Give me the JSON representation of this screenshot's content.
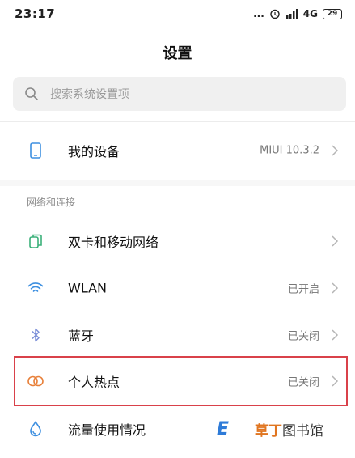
{
  "status_bar": {
    "time": "23:17",
    "dots": "...",
    "network": "4G",
    "battery": "29"
  },
  "header": {
    "title": "设置"
  },
  "search": {
    "placeholder": "搜索系统设置项"
  },
  "device_row": {
    "label": "我的设备",
    "value": "MIUI 10.3.2"
  },
  "section": {
    "title": "网络和连接"
  },
  "rows": [
    {
      "label": "双卡和移动网络",
      "value": ""
    },
    {
      "label": "WLAN",
      "value": "已开启"
    },
    {
      "label": "蓝牙",
      "value": "已关闭"
    },
    {
      "label": "个人热点",
      "value": "已关闭"
    },
    {
      "label": "流量使用情况",
      "value": ""
    }
  ],
  "watermark": {
    "logo": "E",
    "text_a": "草丁",
    "text_b": "图书馆"
  },
  "colors": {
    "highlight": "#d9414a",
    "icon_blue": "#3d8fe0",
    "icon_green": "#3bb07a",
    "icon_orange": "#e8803a"
  }
}
